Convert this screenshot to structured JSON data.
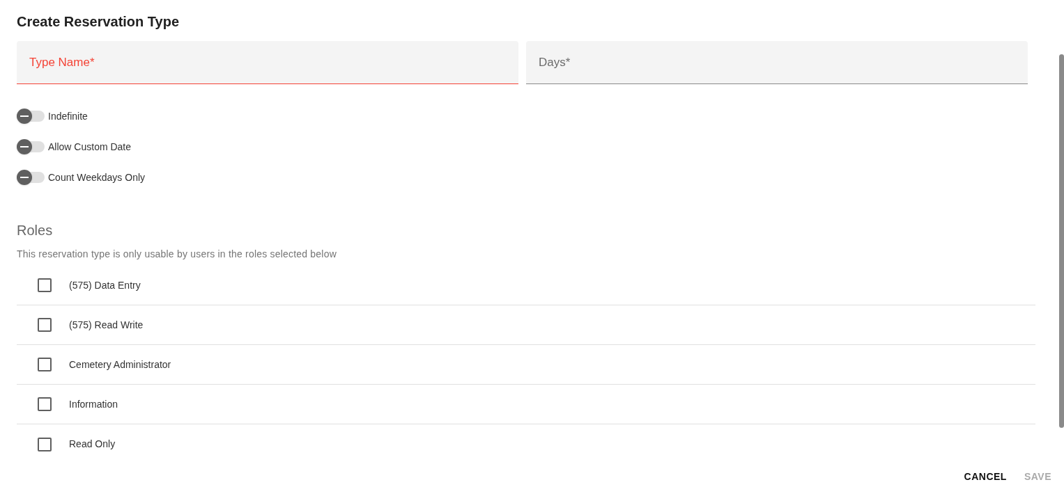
{
  "title": "Create Reservation Type",
  "fields": [
    {
      "label": "Type Name*",
      "error": true
    },
    {
      "label": "Days*",
      "error": false
    }
  ],
  "toggles": [
    {
      "label": "Indefinite",
      "on": false
    },
    {
      "label": "Allow Custom Date",
      "on": false
    },
    {
      "label": "Count Weekdays Only",
      "on": false
    }
  ],
  "roles": {
    "heading": "Roles",
    "description": "This reservation type is only usable by users in the roles selected below",
    "items": [
      {
        "label": "(575) Data Entry",
        "checked": false
      },
      {
        "label": "(575) Read Write",
        "checked": false
      },
      {
        "label": "Cemetery Administrator",
        "checked": false
      },
      {
        "label": "Information",
        "checked": false
      },
      {
        "label": "Read Only",
        "checked": false
      }
    ]
  },
  "buttons": [
    {
      "label": "CANCEL",
      "disabled": false
    },
    {
      "label": "SAVE",
      "disabled": true
    }
  ]
}
